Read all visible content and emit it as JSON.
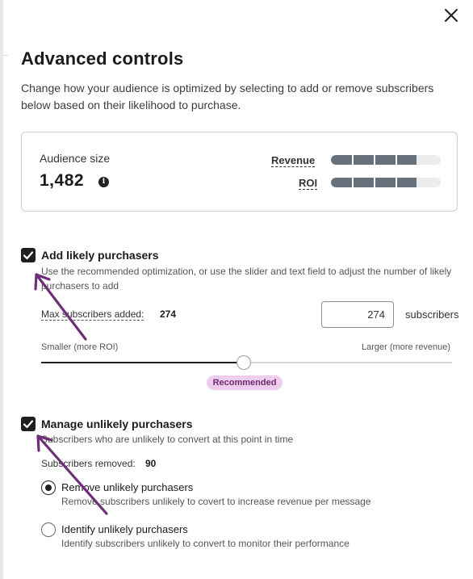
{
  "dialog": {
    "title": "Advanced controls",
    "description": "Change how your audience is optimized by selecting to add or remove subscribers below based on their likelihood to purchase."
  },
  "summary": {
    "audience_label": "Audience size",
    "audience_value": "1,482",
    "info_icon": "info-icon",
    "revenue_label": "Revenue",
    "revenue_level": 0.78,
    "roi_label": "ROI",
    "roi_level": 0.78
  },
  "add_section": {
    "checked": true,
    "title": "Add likely purchasers",
    "description": "Use the recommended optimization, or use the slider and text field to adjust the number of likely purchasers to add",
    "max_label": "Max subscribers added:",
    "max_value": "274",
    "input_value": "274",
    "input_unit": "subscribers",
    "slider_left_label": "Smaller (more ROI)",
    "slider_right_label": "Larger (more revenue)",
    "slider_level": 0.495,
    "badge": "Recommended"
  },
  "manage_section": {
    "checked": true,
    "title": "Manage unlikely purchasers",
    "description": "Subscribers who are unlikely to convert at this point in time",
    "removed_label": "Subscribers removed:",
    "removed_value": "90",
    "options": [
      {
        "title": "Remove unlikely purchasers",
        "description": "Remove subscribers unlikely to covert to increase revenue per message",
        "selected": true
      },
      {
        "title": "Identify unlikely purchasers",
        "description": "Identify subscribers unlikely to convert to monitor their performance",
        "selected": false
      }
    ]
  },
  "colors": {
    "bar_fill": "#67717b",
    "badge_bg": "#efcdef",
    "arrow": "#6e2f78"
  }
}
